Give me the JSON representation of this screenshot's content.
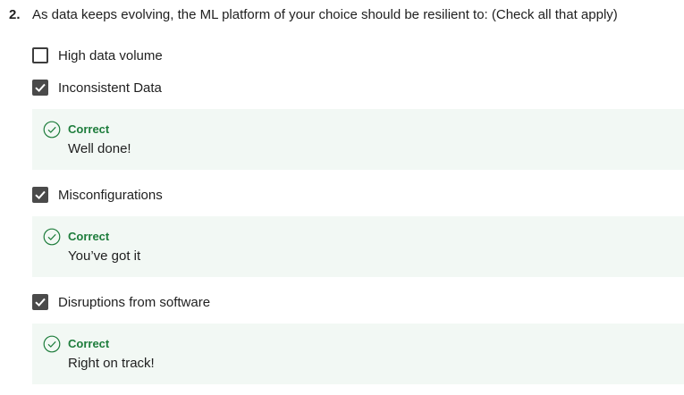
{
  "question": {
    "number": "2.",
    "text": "As data keeps evolving, the ML platform of your choice should be resilient to: (Check all that apply)"
  },
  "options": [
    {
      "label": "High data volume",
      "checked": false
    },
    {
      "label": "Inconsistent Data",
      "checked": true
    },
    {
      "label": "Misconfigurations",
      "checked": true
    },
    {
      "label": "Disruptions from software",
      "checked": true
    }
  ],
  "feedback": [
    {
      "status": "Correct",
      "message": "Well done!"
    },
    {
      "status": "Correct",
      "message": "You’ve got it"
    },
    {
      "status": "Correct",
      "message": "Right on track!"
    }
  ],
  "colors": {
    "correct_green": "#1e7d3c",
    "feedback_bg": "#f2f8f4",
    "checkbox_checked": "#4a4a4a"
  },
  "icons": {
    "checked": "checkmark-icon",
    "feedback": "check-circle-icon"
  }
}
